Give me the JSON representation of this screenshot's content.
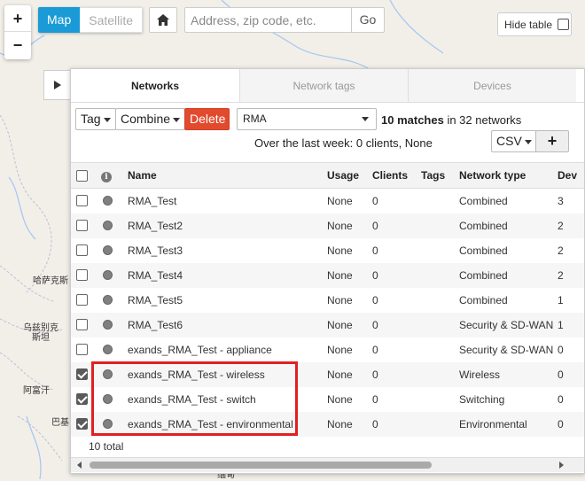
{
  "map": {
    "labels": [
      "哈萨克斯",
      "乌兹别克",
      "斯坦",
      "阿富汗",
      "巴基",
      "缅甸"
    ],
    "zoom_in": "+",
    "zoom_out": "−",
    "type_map": "Map",
    "type_satellite": "Satellite",
    "address_placeholder": "Address, zip code, etc.",
    "go_label": "Go",
    "hide_table_label": "Hide table"
  },
  "panel": {
    "tabs": [
      {
        "label": "Networks",
        "active": true
      },
      {
        "label": "Network tags",
        "active": false
      },
      {
        "label": "Devices",
        "active": false
      }
    ],
    "toolbar": {
      "tag_label": "Tag",
      "combine_label": "Combine",
      "delete_label": "Delete",
      "search_value": "RMA",
      "matches_count": "10 matches",
      "matches_rest": "in 32 networks",
      "summary": "Over the last week: 0 clients, None",
      "csv_label": "CSV",
      "add_label": "+"
    },
    "table": {
      "columns": [
        "Name",
        "Usage",
        "Clients",
        "Tags",
        "Network type",
        "Dev"
      ],
      "rows": [
        {
          "checked": false,
          "name": "RMA_Test",
          "usage": "None",
          "clients": "0",
          "tags": "",
          "type": "Combined",
          "devices": "3"
        },
        {
          "checked": false,
          "name": "RMA_Test2",
          "usage": "None",
          "clients": "0",
          "tags": "",
          "type": "Combined",
          "devices": "2"
        },
        {
          "checked": false,
          "name": "RMA_Test3",
          "usage": "None",
          "clients": "0",
          "tags": "",
          "type": "Combined",
          "devices": "2"
        },
        {
          "checked": false,
          "name": "RMA_Test4",
          "usage": "None",
          "clients": "0",
          "tags": "",
          "type": "Combined",
          "devices": "2"
        },
        {
          "checked": false,
          "name": "RMA_Test5",
          "usage": "None",
          "clients": "0",
          "tags": "",
          "type": "Combined",
          "devices": "1"
        },
        {
          "checked": false,
          "name": "RMA_Test6",
          "usage": "None",
          "clients": "0",
          "tags": "",
          "type": "Security & SD-WAN",
          "devices": "1"
        },
        {
          "checked": false,
          "name": "exands_RMA_Test - appliance",
          "usage": "None",
          "clients": "0",
          "tags": "",
          "type": "Security & SD-WAN",
          "devices": "0"
        },
        {
          "checked": true,
          "name": "exands_RMA_Test - wireless",
          "usage": "None",
          "clients": "0",
          "tags": "",
          "type": "Wireless",
          "devices": "0"
        },
        {
          "checked": true,
          "name": "exands_RMA_Test - switch",
          "usage": "None",
          "clients": "0",
          "tags": "",
          "type": "Switching",
          "devices": "0"
        },
        {
          "checked": true,
          "name": "exands_RMA_Test - environmental",
          "usage": "None",
          "clients": "0",
          "tags": "",
          "type": "Environmental",
          "devices": "0"
        }
      ],
      "total": "10 total"
    }
  },
  "colors": {
    "accent": "#1a9bd7",
    "delete": "#e24a2e",
    "highlight": "#e02020"
  }
}
